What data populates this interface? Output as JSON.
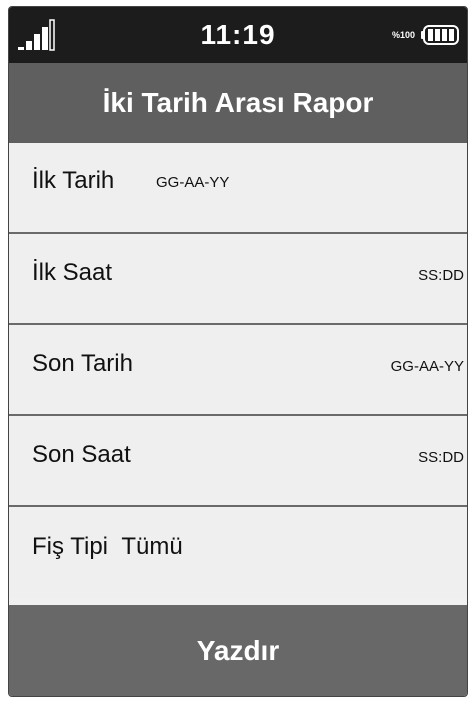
{
  "status_bar": {
    "time": "11:19",
    "battery_percent": "%100",
    "signal_icon": "signal-bars-icon",
    "battery_icon": "battery-full-icon",
    "battery_level": 1.0
  },
  "header": {
    "title": "İki Tarih Arası Rapor"
  },
  "fields": [
    {
      "label": "İlk Tarih",
      "hint": "GG-AA-YY"
    },
    {
      "label": "İlk Saat",
      "hint": "SS:DD"
    },
    {
      "label": "Son Tarih",
      "hint": "GG-AA-YY"
    },
    {
      "label": "Son Saat",
      "hint": "SS:DD"
    },
    {
      "label": "Fiş Tipi",
      "value": "Tümü"
    }
  ],
  "actions": {
    "print_label": "Yazdır"
  },
  "colors": {
    "status_bar": "#1c1c1c",
    "title_bar": "#5f5f5f",
    "field_background": "#efefef",
    "divider": "#6a6a6a",
    "print_button": "#686868",
    "text_light": "#ffffff",
    "text_dark": "#111111"
  }
}
